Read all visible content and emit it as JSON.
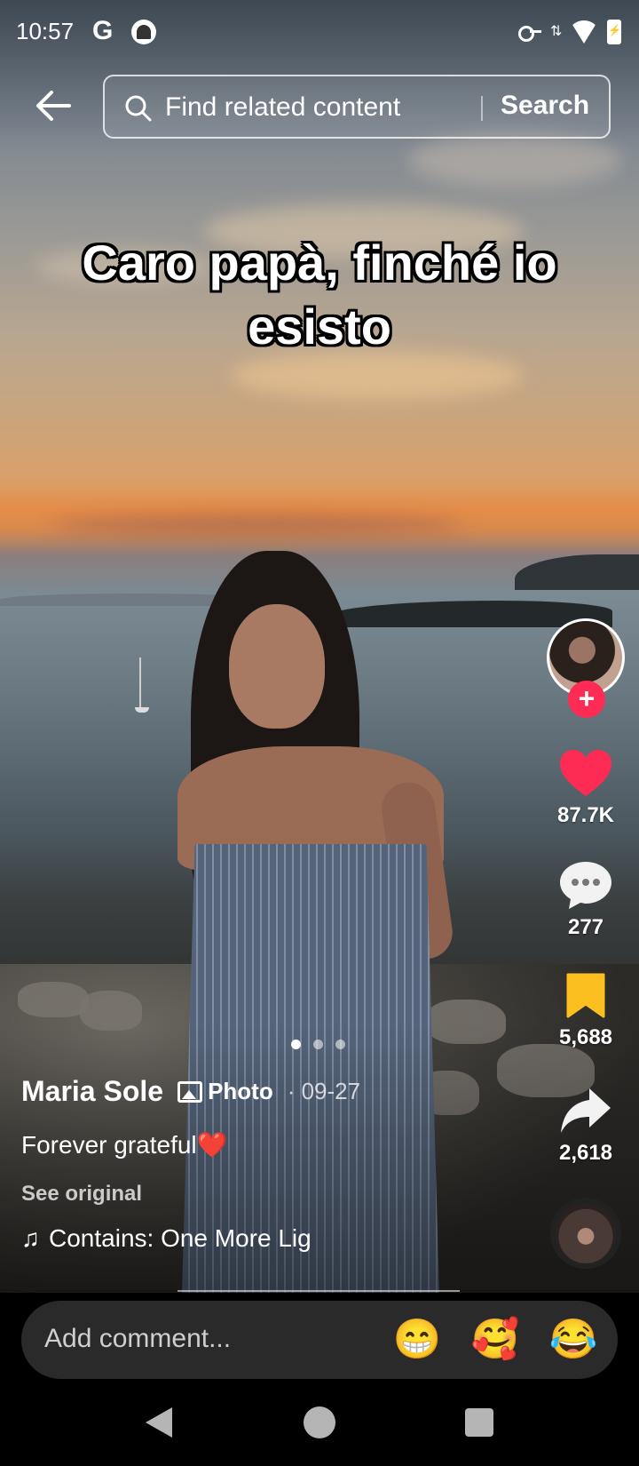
{
  "status_bar": {
    "time": "10:57"
  },
  "search": {
    "placeholder": "Find related content",
    "button_label": "Search"
  },
  "overlay_caption": "Caro papà, finché io esisto",
  "actions": {
    "likes": "87.7K",
    "comments": "277",
    "saves": "5,688",
    "shares": "2,618"
  },
  "carousel": {
    "total": 3,
    "active_index": 0
  },
  "post": {
    "author": "Maria Sole",
    "type_label": "Photo",
    "date": "· 09-27",
    "description": "Forever grateful",
    "description_emoji": "❤️",
    "see_original": "See original",
    "music": "Contains: One More Lig"
  },
  "comment_bar": {
    "placeholder": "Add comment...",
    "emojis": [
      "😁",
      "🥰",
      "😂"
    ]
  },
  "colors": {
    "accent": "#fe2c55",
    "like": "#fe2c55",
    "save": "#fbbf1f"
  },
  "icons": [
    "back-arrow-icon",
    "search-icon",
    "heart-icon",
    "comment-icon",
    "bookmark-icon",
    "share-icon",
    "music-note-icon",
    "photo-icon"
  ]
}
